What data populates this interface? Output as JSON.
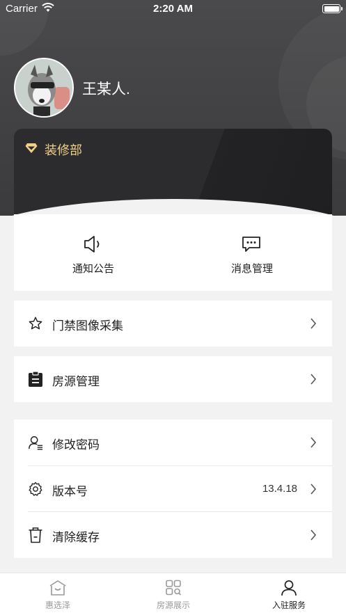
{
  "status_bar": {
    "carrier": "Carrier",
    "time": "2:20 AM"
  },
  "profile": {
    "name": "王某人.",
    "role": "装修部"
  },
  "quick_actions": [
    {
      "label": "通知公告",
      "icon": "speaker-icon"
    },
    {
      "label": "消息管理",
      "icon": "message-icon"
    }
  ],
  "menu_group_1": [
    {
      "label": "门禁图像采集",
      "icon": "star-icon"
    }
  ],
  "menu_group_2": [
    {
      "label": "房源管理",
      "icon": "clipboard-icon"
    }
  ],
  "menu_group_3": [
    {
      "label": "修改密码",
      "icon": "user-edit-icon",
      "value": ""
    },
    {
      "label": "版本号",
      "icon": "settings-icon",
      "value": "13.4.18"
    },
    {
      "label": "清除缓存",
      "icon": "trash-icon",
      "value": ""
    }
  ],
  "tabs": [
    {
      "label": "惠选泽",
      "icon": "home-icon",
      "active": false
    },
    {
      "label": "房源展示",
      "icon": "grid-icon",
      "active": false
    },
    {
      "label": "入驻服务",
      "icon": "person-icon",
      "active": true
    }
  ],
  "colors": {
    "header_bg": "#3b3b3d",
    "vip_gold": "#f1d089",
    "accent_blue": "#2b9bd8"
  }
}
